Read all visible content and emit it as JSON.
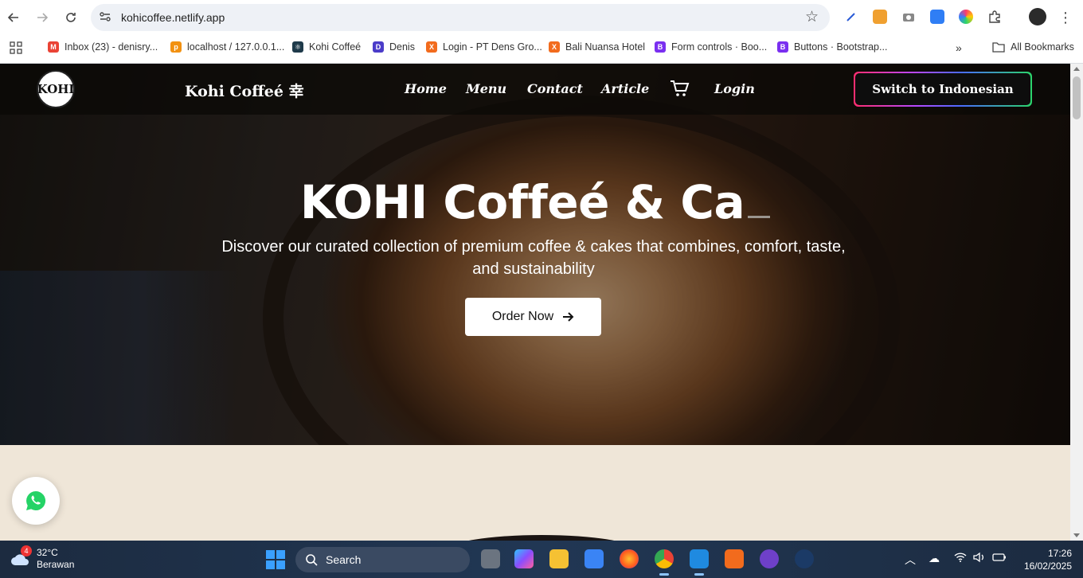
{
  "browser": {
    "url": "kohicoffee.netlify.app",
    "bookmarks": [
      {
        "label": "Inbox (23) - denisry...",
        "color": "#ea4335"
      },
      {
        "label": "localhost / 127.0.0.1...",
        "color": "#f29111"
      },
      {
        "label": "Kohi Coffeé",
        "color": "#1e88a8"
      },
      {
        "label": "Denis",
        "color": "#4b3cc9"
      },
      {
        "label": "Login - PT Dens Gro...",
        "color": "#f26b1d"
      },
      {
        "label": "Bali Nuansa Hotel",
        "color": "#f26b1d"
      },
      {
        "label": "Form controls · Boo...",
        "color": "#7a2ff0"
      },
      {
        "label": "Buttons · Bootstrap...",
        "color": "#7a2ff0"
      }
    ],
    "all_bookmarks": "All Bookmarks"
  },
  "site": {
    "logo_text": "KOHI",
    "brand": "Kohi Coffeé 幸",
    "nav": {
      "home": "Home",
      "menu": "Menu",
      "contact": "Contact",
      "article": "Article",
      "login": "Login"
    },
    "switch_language": "Switch to Indonesian"
  },
  "hero": {
    "title": "KOHI Coffeé & Ca",
    "subtitle": "Discover our curated collection of premium coffee & cakes that combines, comfort, taste, and sustainability",
    "cta": "Order Now"
  },
  "taskbar": {
    "weather_badge": "4",
    "temperature": "32°C",
    "condition": "Berawan",
    "search": "Search",
    "time": "17:26",
    "date": "16/02/2025"
  },
  "colors": {
    "accent_gradient": [
      "#ff2d6f",
      "#b548ff",
      "#4a6bff",
      "#2bd46a"
    ],
    "whatsapp": "#25d366",
    "page_bg": "#efe6d8"
  }
}
